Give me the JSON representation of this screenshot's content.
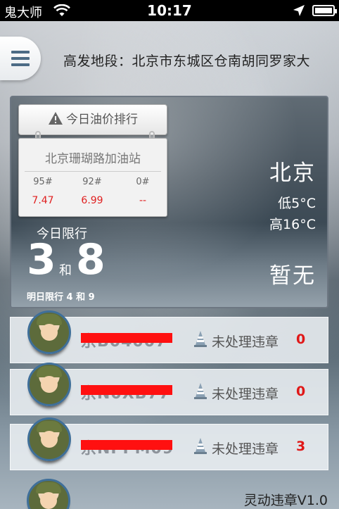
{
  "status_bar": {
    "carrier": "鬼大师",
    "time": "10:17"
  },
  "header": {
    "address": "高发地段：北京市东城区仓南胡同罗家大"
  },
  "oil": {
    "tab_label": "今日油价排行",
    "station": "北京珊瑚路加油站",
    "prices": [
      {
        "grade": "95#",
        "price": "7.47"
      },
      {
        "grade": "92#",
        "price": "6.99"
      },
      {
        "grade": "0#",
        "price": "--"
      }
    ]
  },
  "weather": {
    "city": "北京",
    "low": "低5°C",
    "high": "高16°C",
    "status": "暂无"
  },
  "restriction": {
    "today_label": "今日限行",
    "today_num1": "3",
    "today_and": "和",
    "today_num2": "8",
    "tomorrow": "明日限行 4 和 9"
  },
  "vehicles": [
    {
      "plate": "京B04007",
      "violation_label": "未处理违章",
      "count": "0"
    },
    {
      "plate": "京N0XB77",
      "violation_label": "未处理违章",
      "count": "0"
    },
    {
      "plate": "京NPPM09",
      "violation_label": "未处理违章",
      "count": "3"
    }
  ],
  "footer": {
    "version": "灵动违章V1.0"
  },
  "colors": {
    "accent_red": "#e01818",
    "menu_blue": "#4c6b85",
    "avatar_ring": "#3f6f99"
  },
  "icons": [
    "wifi-icon",
    "location-icon",
    "battery-icon",
    "menu-icon",
    "warning-icon",
    "traffic-cone-icon"
  ]
}
